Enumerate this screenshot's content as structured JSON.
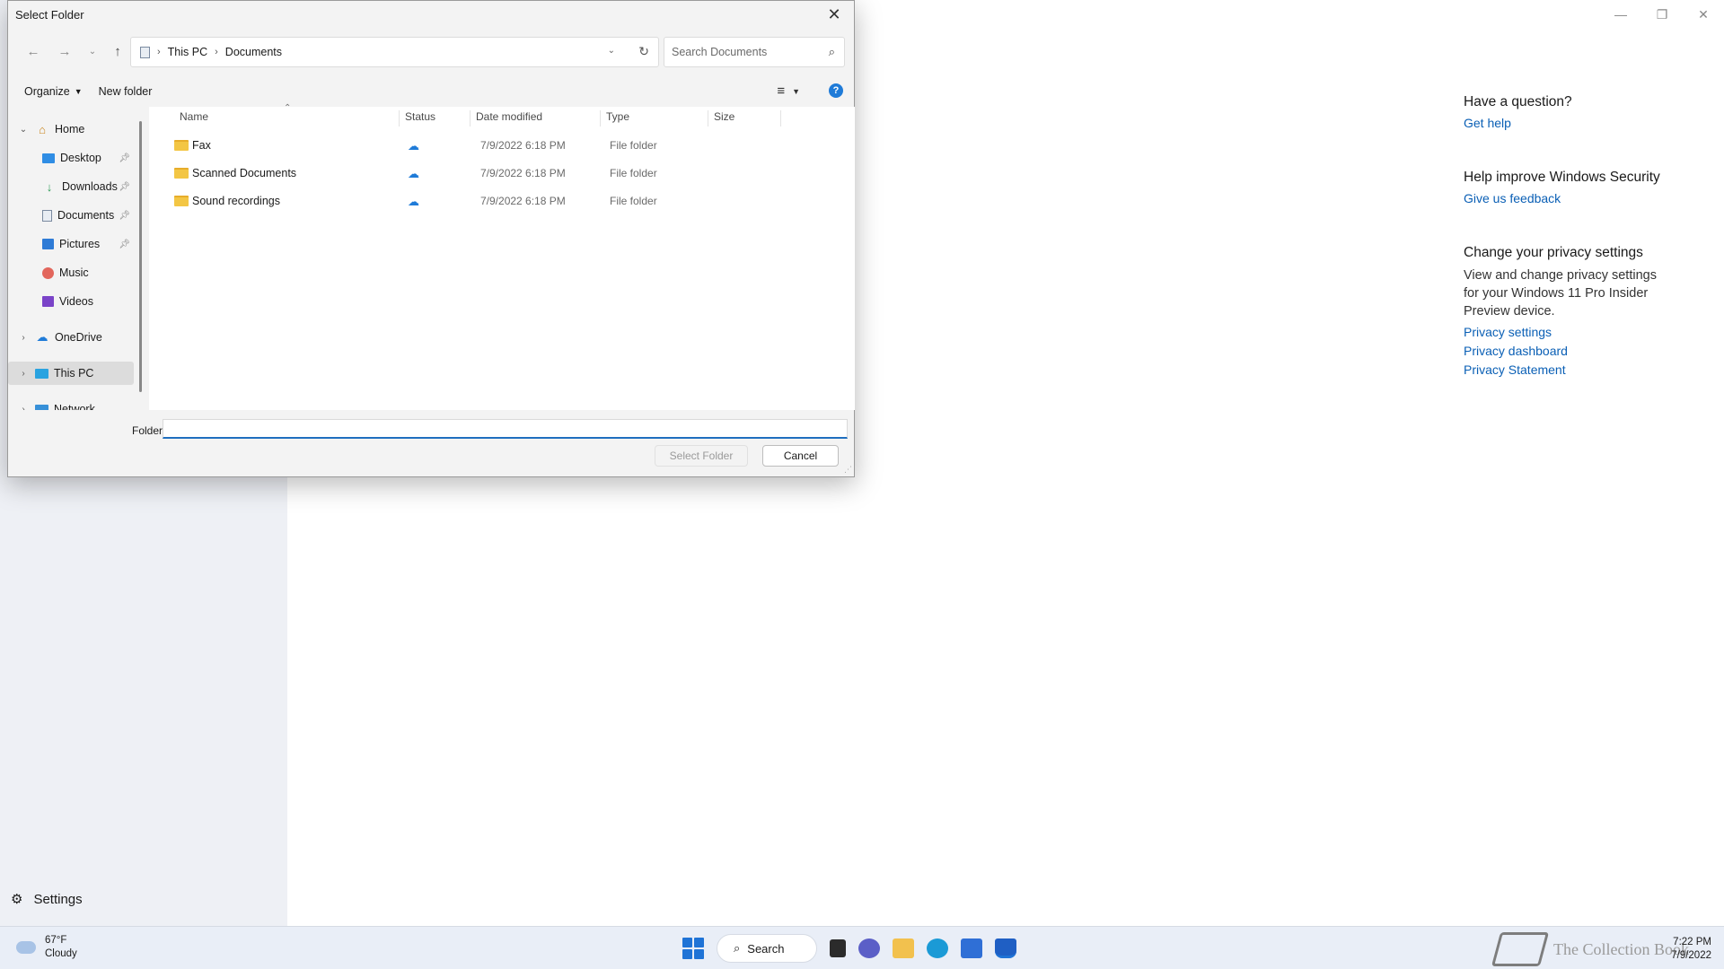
{
  "app": {
    "settings_label": "Settings",
    "right_panel": {
      "question_title": "Have a question?",
      "get_help": "Get help",
      "improve_title": "Help improve Windows Security",
      "feedback": "Give us feedback",
      "privacy_title": "Change your privacy settings",
      "privacy_desc": "View and change privacy settings for your Windows 11 Pro Insider Preview device.",
      "links": [
        "Privacy settings",
        "Privacy dashboard",
        "Privacy Statement"
      ]
    }
  },
  "dialog": {
    "title": "Select Folder",
    "breadcrumb": [
      "This PC",
      "Documents"
    ],
    "search_placeholder": "Search Documents",
    "organize": "Organize",
    "new_folder": "New folder",
    "nav": [
      {
        "label": "Home",
        "icon": "home-icon",
        "expanded": true
      },
      {
        "label": "Desktop",
        "icon": "desktop-icon",
        "pinned": true
      },
      {
        "label": "Downloads",
        "icon": "downloads-icon",
        "pinned": true
      },
      {
        "label": "Documents",
        "icon": "documents-icon",
        "pinned": true
      },
      {
        "label": "Pictures",
        "icon": "pictures-icon",
        "pinned": true
      },
      {
        "label": "Music",
        "icon": "music-icon"
      },
      {
        "label": "Videos",
        "icon": "videos-icon"
      },
      {
        "label": "OneDrive",
        "icon": "onedrive-icon"
      },
      {
        "label": "This PC",
        "icon": "this-pc-icon",
        "selected": true
      },
      {
        "label": "Network",
        "icon": "network-icon"
      }
    ],
    "columns": [
      "Name",
      "Status",
      "Date modified",
      "Type",
      "Size"
    ],
    "files": [
      {
        "name": "Fax",
        "date": "7/9/2022 6:18 PM",
        "type": "File folder"
      },
      {
        "name": "Scanned Documents",
        "date": "7/9/2022 6:18 PM",
        "type": "File folder"
      },
      {
        "name": "Sound recordings",
        "date": "7/9/2022 6:18 PM",
        "type": "File folder"
      }
    ],
    "folder_label": "Folder:",
    "folder_value": "",
    "select_button": "Select Folder",
    "cancel_button": "Cancel"
  },
  "taskbar": {
    "temperature": "67°F",
    "condition": "Cloudy",
    "search_label": "Search",
    "watermark": "The Collection Book",
    "time": "7:22 PM",
    "date": "7/9/2022"
  }
}
